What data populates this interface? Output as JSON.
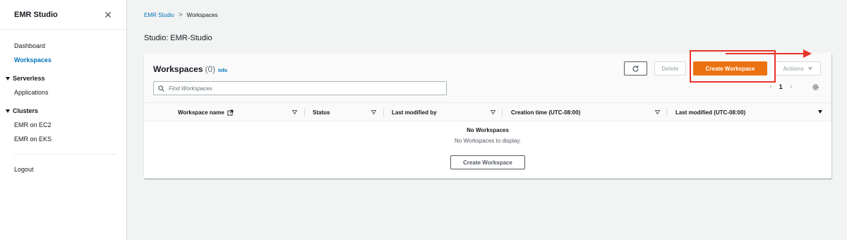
{
  "sidebar": {
    "title": "EMR Studio",
    "close_glyph": "✕",
    "links_top": [
      {
        "label": "Dashboard",
        "active": false
      },
      {
        "label": "Workspaces",
        "active": true
      }
    ],
    "serverless": {
      "label": "Serverless",
      "items": [
        "Applications"
      ]
    },
    "clusters": {
      "label": "Clusters",
      "items": [
        "EMR on EC2",
        "EMR on EKS"
      ]
    },
    "logout": "Logout"
  },
  "breadcrumb": {
    "root": "EMR Studio",
    "separator": ">",
    "current": "Workspaces"
  },
  "page_title": "Studio: EMR-Studio",
  "panel": {
    "title": "Workspaces",
    "count": "(0)",
    "info": "Info",
    "buttons": {
      "delete": "Delete",
      "create": "Create Workspace",
      "actions": "Actions"
    },
    "search_placeholder": "Find Workspaces",
    "pagination": {
      "current_page": "1"
    },
    "columns": [
      "Workspace name",
      "Status",
      "Last modified by",
      "Creation time (UTC-08:00)",
      "Last modified (UTC-08:00)"
    ],
    "empty": {
      "title": "No Workspaces",
      "description": "No Workspaces to display.",
      "button": "Create Workspace"
    }
  },
  "colors": {
    "accent_orange": "#ec7211",
    "link_blue": "#0073bb",
    "annotation_red": "#e8352a"
  },
  "icons": [
    "close-icon",
    "refresh-icon",
    "search-icon",
    "external-link-icon",
    "settings-gear-icon",
    "chevron-left-icon",
    "chevron-right-icon",
    "sort-icon"
  ]
}
